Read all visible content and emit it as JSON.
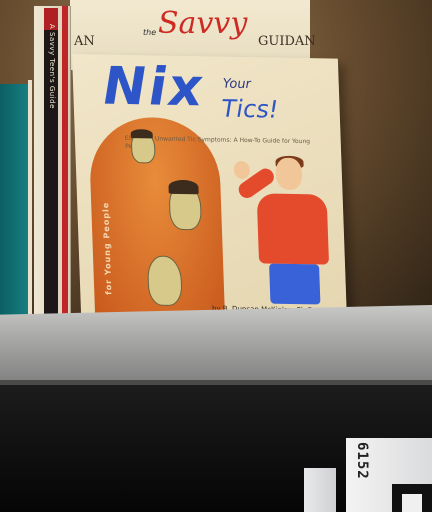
{
  "back_book": {
    "title_script": "Savvy",
    "small_word": "the",
    "left_fragment": "AN",
    "right_fragment": "GUIDAN"
  },
  "spine": {
    "text": "A Savvy Teen's Guide"
  },
  "cover": {
    "title_nix": "Nix",
    "title_your": "Your",
    "title_tics": "Tics!",
    "subtitle": "Eliminate Unwanted Tic Symptoms: A How-To Guide for Young People",
    "arch_text": "for Young People",
    "author": "by B. Duncan McKinlay, Ph.D."
  },
  "shelf_label": {
    "number": "6152"
  },
  "colors": {
    "title_blue": "#2d55c8",
    "arch_orange": "#c8581c",
    "back_title_red": "#cc2a22",
    "shirt_red": "#e44b2c",
    "shelf_grey": "#a9aaa8"
  }
}
